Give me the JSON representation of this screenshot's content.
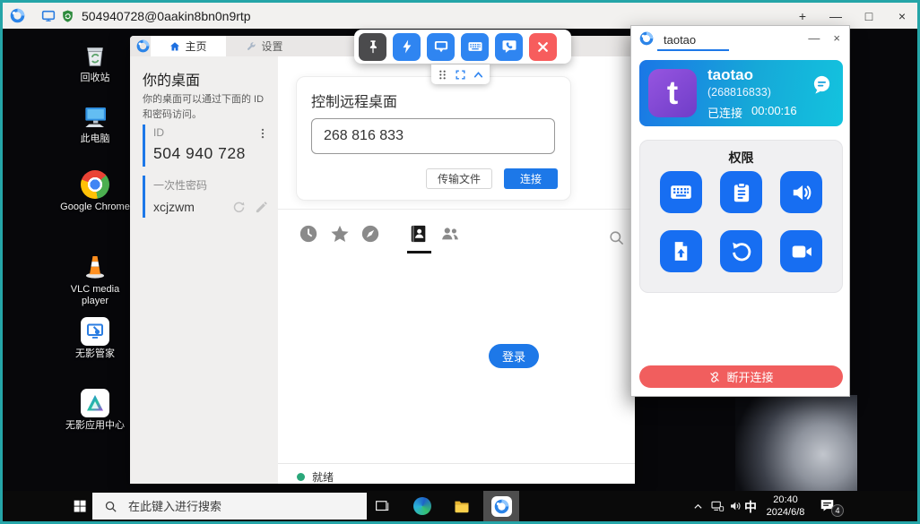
{
  "frame": {
    "title": "504940728@0aakin8bn0n9rtp",
    "controls": {
      "new_tab": "+",
      "minimize": "—",
      "maximize": "□",
      "close": "×"
    }
  },
  "desktop": {
    "icons": [
      {
        "label": "回收站"
      },
      {
        "label": "此电脑"
      },
      {
        "label": "Google Chrome"
      },
      {
        "label": "VLC media player"
      },
      {
        "label": "无影管家"
      },
      {
        "label": "无影应用中心"
      }
    ]
  },
  "app": {
    "tabs": {
      "home": "主页",
      "settings": "设置"
    },
    "your_desktop": {
      "title": "你的桌面",
      "description": "你的桌面可以通过下面的 ID 和密码访问。",
      "id_label": "ID",
      "id_value": "504 940 728",
      "password_label": "一次性密码",
      "password_value": "xcjzwm"
    },
    "remote_control": {
      "title": "控制远程桌面",
      "remote_id": "268 816 833",
      "transfer_button": "传输文件",
      "connect_button": "连接"
    },
    "address_book": {
      "login_button": "登录"
    },
    "status": {
      "text": "就绪"
    }
  },
  "remote_toolbar": {
    "icons": [
      "pin",
      "actions",
      "display",
      "keyboard",
      "chat",
      "close"
    ]
  },
  "mini_toolbar": {
    "icons": [
      "drag-grid",
      "fullscreen",
      "collapse"
    ]
  },
  "session_panel": {
    "tab_label": "taotao",
    "minimize": "—",
    "close": "×",
    "peer": {
      "avatar_letter": "t",
      "name": "taotao",
      "id": "(268816833)",
      "status": "已连接",
      "duration": "00:00:16"
    },
    "permissions": {
      "title": "权限",
      "buttons": [
        "keyboard",
        "clipboard",
        "audio",
        "file-transfer",
        "restart",
        "camera"
      ]
    },
    "disconnect_button": "断开连接"
  },
  "taskbar": {
    "search_placeholder": "在此键入进行搜索",
    "ime": "中",
    "time": "20:40",
    "date": "2024/6/8",
    "notification_count": "4"
  },
  "colors": {
    "frame_teal": "#25a5a8",
    "accent_blue": "#1d78e8",
    "permission_blue": "#176ef2",
    "disconnect_red": "#f15e5e",
    "close_red": "#f75d5d",
    "toolbar_dark": "#4b4b4d",
    "card_gradient_start": "#1b76e6",
    "card_gradient_end": "#13c3de",
    "avatar_purple": "#7e46d0",
    "status_green": "#2aa77a"
  }
}
